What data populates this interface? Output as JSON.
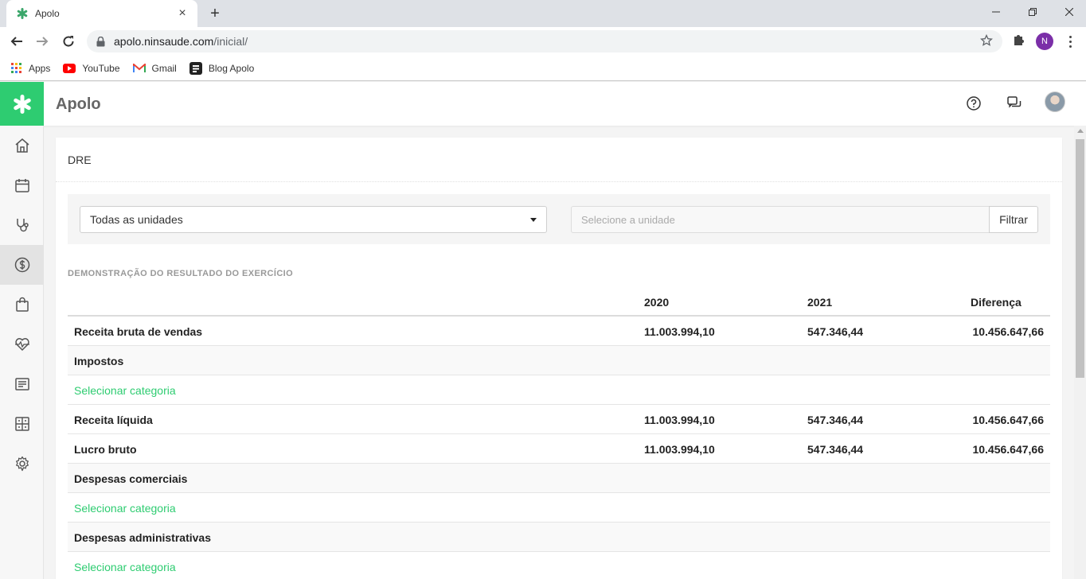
{
  "browser": {
    "tab_title": "Apolo",
    "url_host": "apolo.ninsaude.com",
    "url_path": "/inicial/",
    "profile_initial": "N",
    "bookmarks": [
      {
        "label": "Apps",
        "icon": "apps-grid-icon"
      },
      {
        "label": "YouTube",
        "icon": "youtube-icon"
      },
      {
        "label": "Gmail",
        "icon": "gmail-icon"
      },
      {
        "label": "Blog Apolo",
        "icon": "blog-icon"
      }
    ]
  },
  "app": {
    "title": "Apolo",
    "brand_color": "#2ecc71",
    "sidebar": [
      {
        "name": "home",
        "icon": "home-icon"
      },
      {
        "name": "calendar",
        "icon": "calendar-icon"
      },
      {
        "name": "clinical",
        "icon": "stethoscope-icon"
      },
      {
        "name": "finance",
        "icon": "dollar-icon",
        "active": true
      },
      {
        "name": "shop",
        "icon": "shopping-bag-icon"
      },
      {
        "name": "health",
        "icon": "heart-pulse-icon"
      },
      {
        "name": "reports",
        "icon": "list-icon"
      },
      {
        "name": "dashboard",
        "icon": "grid-icon"
      },
      {
        "name": "settings",
        "icon": "gear-icon"
      }
    ]
  },
  "page": {
    "title": "DRE",
    "filters": {
      "unit_select_value": "Todas as unidades",
      "unit_input_placeholder": "Selecione a unidade",
      "filter_button": "Filtrar"
    },
    "section_title": "DEMONSTRAÇÃO DO RESULTADO DO EXERCÍCIO",
    "table": {
      "headers": [
        "2020",
        "2021",
        "Diferença"
      ],
      "rows": [
        {
          "label": "Receita bruta de vendas",
          "v2020": "11.003.994,10",
          "v2021": "547.346,44",
          "diff": "10.456.647,66",
          "type": "total"
        },
        {
          "label": "Impostos",
          "v2020": "",
          "v2021": "",
          "diff": "",
          "type": "group"
        },
        {
          "label": "Selecionar categoria",
          "v2020": "",
          "v2021": "",
          "diff": "",
          "type": "link"
        },
        {
          "label": "Receita líquida",
          "v2020": "11.003.994,10",
          "v2021": "547.346,44",
          "diff": "10.456.647,66",
          "type": "total"
        },
        {
          "label": "Lucro bruto",
          "v2020": "11.003.994,10",
          "v2021": "547.346,44",
          "diff": "10.456.647,66",
          "type": "total"
        },
        {
          "label": "Despesas comerciais",
          "v2020": "",
          "v2021": "",
          "diff": "",
          "type": "group"
        },
        {
          "label": "Selecionar categoria",
          "v2020": "",
          "v2021": "",
          "diff": "",
          "type": "link"
        },
        {
          "label": "Despesas administrativas",
          "v2020": "",
          "v2021": "",
          "diff": "",
          "type": "group"
        },
        {
          "label": "Selecionar categoria",
          "v2020": "",
          "v2021": "",
          "diff": "",
          "type": "link"
        }
      ]
    }
  }
}
